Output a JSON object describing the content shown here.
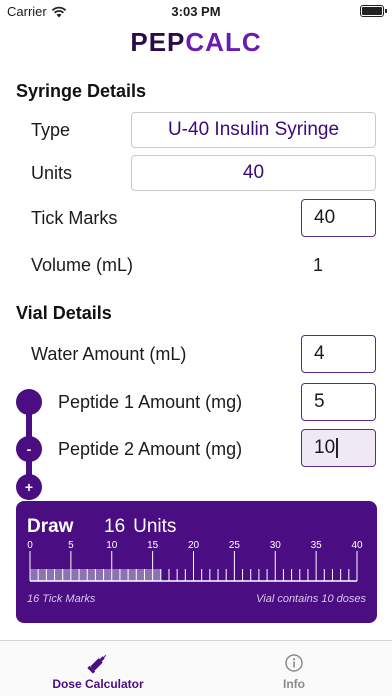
{
  "status_bar": {
    "carrier": "Carrier",
    "time": "3:03 PM"
  },
  "logo": {
    "part1": "PEP",
    "part2": "CALC"
  },
  "syringe": {
    "title": "Syringe Details",
    "type_label": "Type",
    "type_value": "U-40 Insulin Syringe",
    "units_label": "Units",
    "units_value": "40",
    "tick_label": "Tick Marks",
    "tick_value": "40",
    "volume_label": "Volume (mL)",
    "volume_value": "1"
  },
  "vial": {
    "title": "Vial Details",
    "water_label": "Water Amount (mL)",
    "water_value": "4",
    "peptide1_label": "Peptide 1 Amount (mg)",
    "peptide1_value": "5",
    "peptide2_label": "Peptide 2 Amount (mg)",
    "peptide2_value": "10",
    "remove_symbol": "-",
    "add_symbol": "+"
  },
  "draw": {
    "title": "Draw",
    "amount": "16",
    "unit": "Units",
    "ruler_max": 40,
    "ruler_labels": [
      "0",
      "5",
      "10",
      "15",
      "20",
      "25",
      "30",
      "35",
      "40"
    ],
    "tick_marks_text": "16 Tick Marks",
    "doses_text": "Vial contains 10 doses"
  },
  "tabs": [
    {
      "label": "Dose Calculator",
      "icon": "syringe-icon",
      "active": true
    },
    {
      "label": "Info",
      "icon": "info-icon",
      "active": false
    }
  ],
  "colors": {
    "accent": "#4a0d82",
    "logo_dark": "#2b0a4a",
    "logo_light": "#6a1bb0"
  }
}
